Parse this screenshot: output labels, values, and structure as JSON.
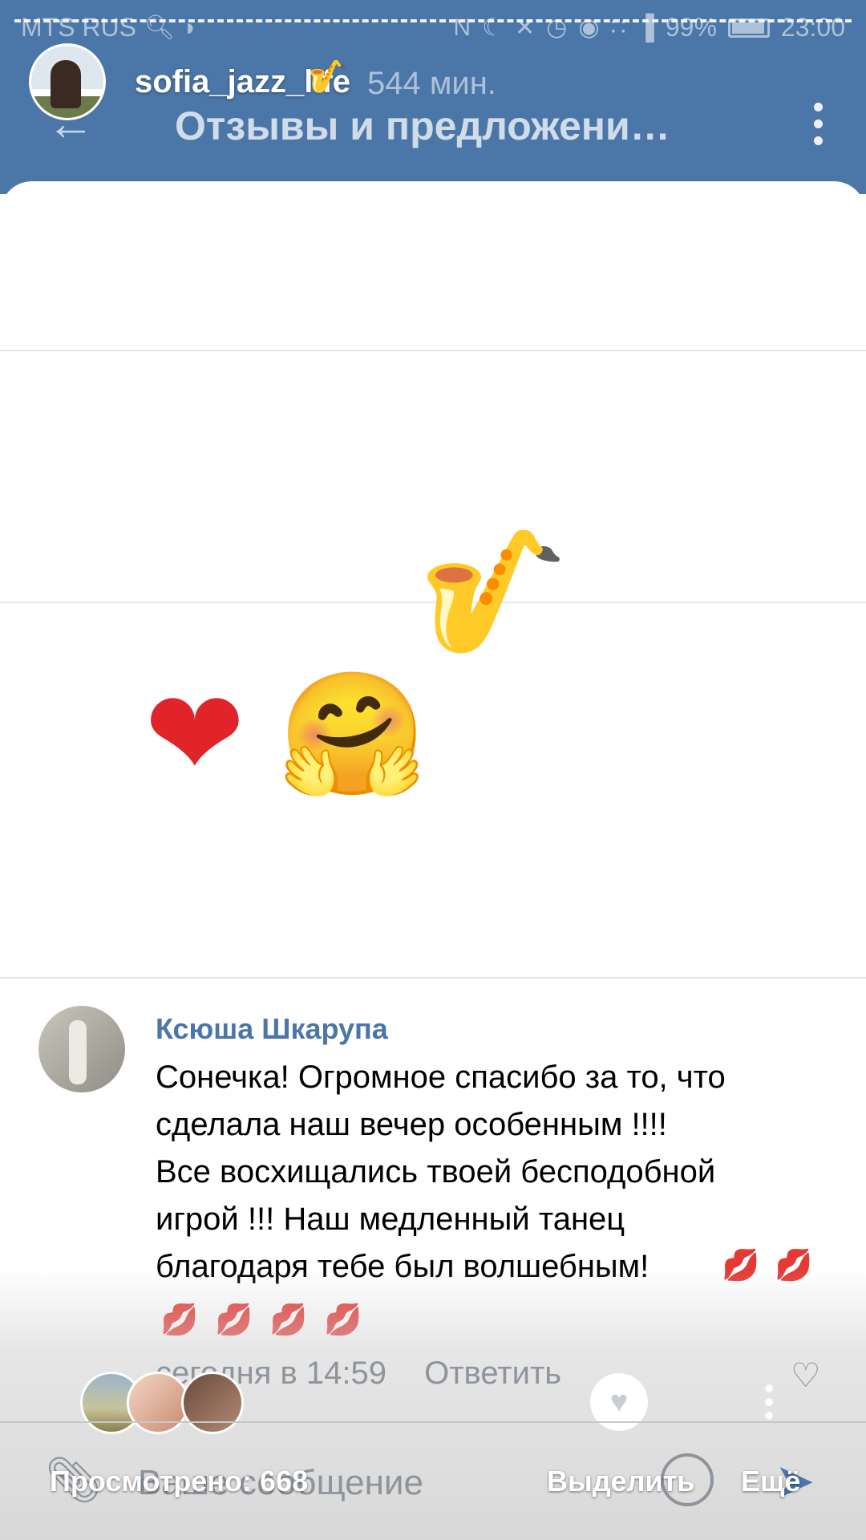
{
  "statusbar": {
    "carrier": "MTS RUS",
    "battery": "99%",
    "time": "23:00"
  },
  "story": {
    "username": "sofia_jazz_life",
    "username_emoji": "🎷"
  },
  "vk": {
    "back_icon": "←",
    "header_time": "544 мин.",
    "title": "Отзывы и предложени…"
  },
  "post": {
    "emojis": {
      "sax": "🎷",
      "heart": "❤",
      "hug": "🤗"
    }
  },
  "comment": {
    "author": "Ксюша Шкарупа",
    "lines": [
      "Сонечка! Огромное спасибо за то, что",
      "сделала наш вечер особенным !!!!",
      "Все  восхищались твоей бесподобной",
      "игрой !!! Наш медленный танец",
      "благодаря тебе был волшебным!"
    ],
    "kiss": "💋",
    "time": "сегодня в 14:59",
    "reply_label": "Ответить"
  },
  "input": {
    "placeholder": "Ваше сообщение"
  },
  "story_footer": {
    "viewed_label": "Просмотрено: 668",
    "select_label": "Выделить",
    "more_label": "Ещё"
  },
  "colors": {
    "vk_blue": "#4a76a8",
    "link_blue": "#4a76a8",
    "meta_gray": "#8d949c"
  }
}
